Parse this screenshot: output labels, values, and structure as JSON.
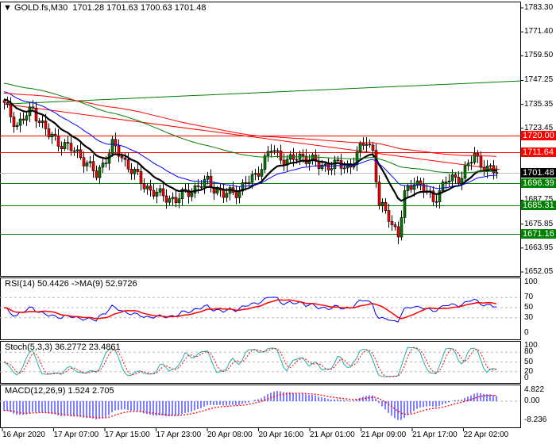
{
  "header": {
    "symbol": "GOLD.fs,M30",
    "ohlc": "1701.28 1701.63 1700.63 1701.48"
  },
  "price_axis": [
    "1783.30",
    "1771.40",
    "1759.50",
    "1747.25",
    "1735.35",
    "1723.45",
    "1711.64",
    "1699.75",
    "1687.75",
    "1675.85",
    "1663.95",
    "1652.05"
  ],
  "levels": [
    {
      "label": "1720.00",
      "price": 1720.0,
      "color": "#ff0000"
    },
    {
      "label": "1711.64",
      "price": 1711.64,
      "color": "#ff0000"
    },
    {
      "label": "1701.48",
      "price": 1701.48,
      "color": "#000000"
    },
    {
      "label": "1696.39",
      "price": 1696.39,
      "color": "#008000"
    },
    {
      "label": "1685.31",
      "price": 1685.31,
      "color": "#008000"
    },
    {
      "label": "1671.16",
      "price": 1671.16,
      "color": "#008000"
    }
  ],
  "rsi": {
    "label": "RSI(14) 50.4426  ->MA(9) 52.9726",
    "levels": [
      "100",
      "70",
      "50",
      "30",
      "0"
    ]
  },
  "stoch": {
    "label": "Stoch(5,3,3) 36.2772 23.4861",
    "levels": [
      "100",
      "80",
      "50",
      "20",
      "0"
    ]
  },
  "macd": {
    "label": "MACD(12,26,9) 1.524 2.705",
    "levels": [
      "4.822",
      "0.00",
      "-8.236"
    ]
  },
  "time_axis": [
    "16 Apr 2020",
    "17 Apr 07:00",
    "17 Apr 15:00",
    "17 Apr 23:00",
    "20 Apr 08:00",
    "20 Apr 16:00",
    "21 Apr 01:00",
    "21 Apr 09:00",
    "21 Apr 17:00",
    "22 Apr 02:00"
  ],
  "chart_data": {
    "type": "candlestick",
    "title": "GOLD.fs,M30",
    "ylim": [
      1652.05,
      1783.3
    ],
    "bars": 156,
    "key_closes": [
      [
        0,
        1735
      ],
      [
        4,
        1725
      ],
      [
        9,
        1733
      ],
      [
        14,
        1720
      ],
      [
        19,
        1715
      ],
      [
        24,
        1710
      ],
      [
        29,
        1700
      ],
      [
        34,
        1715
      ],
      [
        39,
        1705
      ],
      [
        44,
        1695
      ],
      [
        49,
        1690
      ],
      [
        54,
        1688
      ],
      [
        59,
        1693
      ],
      [
        64,
        1697
      ],
      [
        69,
        1690
      ],
      [
        74,
        1693
      ],
      [
        79,
        1700
      ],
      [
        84,
        1713
      ],
      [
        89,
        1707
      ],
      [
        94,
        1710
      ],
      [
        99,
        1705
      ],
      [
        104,
        1705
      ],
      [
        109,
        1705
      ],
      [
        114,
        1718
      ],
      [
        116,
        1712
      ],
      [
        118,
        1685
      ],
      [
        121,
        1680
      ],
      [
        124,
        1670
      ],
      [
        126,
        1690
      ],
      [
        129,
        1698
      ],
      [
        132,
        1693
      ],
      [
        135,
        1688
      ],
      [
        139,
        1697
      ],
      [
        144,
        1700
      ],
      [
        148,
        1710
      ],
      [
        152,
        1703
      ],
      [
        155,
        1701.48
      ]
    ],
    "moving_averages": [
      {
        "period": 14,
        "color": "#000000",
        "seed": 1738
      },
      {
        "period": 30,
        "color": "#0000ff",
        "seed": 1742
      },
      {
        "period": 100,
        "color": "#008000",
        "seed": 1746
      },
      {
        "period": 200,
        "color": "#ff0000",
        "seed": 1741
      }
    ],
    "trendlines": [
      {
        "color": "#008000",
        "from": [
          0,
          1735.5
        ],
        "to": [
          163,
          1747.0
        ]
      },
      {
        "color": "#ff0000",
        "from": [
          0,
          1735.5
        ],
        "to": [
          156,
          1703.0
        ]
      }
    ]
  }
}
